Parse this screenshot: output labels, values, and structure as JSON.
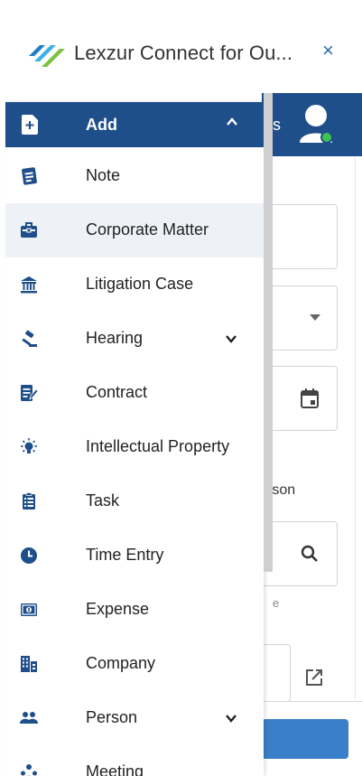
{
  "window": {
    "title": "Lexzur Connect for Ou...",
    "close_glyph": "×",
    "brand_color": "#1f4f8a",
    "accent_color": "#2b6cb0"
  },
  "background_form": {
    "header_text": "s",
    "person_fragment": "rson",
    "hint_fragment": "e"
  },
  "menu": {
    "header_label": "Add",
    "items": [
      {
        "label": "Note",
        "icon": "note-icon"
      },
      {
        "label": "Corporate Matter",
        "icon": "briefcase-icon",
        "active": true
      },
      {
        "label": "Litigation Case",
        "icon": "courthouse-icon"
      },
      {
        "label": "Hearing",
        "icon": "gavel-icon",
        "expandable": true
      },
      {
        "label": "Contract",
        "icon": "contract-edit-icon"
      },
      {
        "label": "Intellectual Property",
        "icon": "lightbulb-icon"
      },
      {
        "label": "Task",
        "icon": "clipboard-list-icon"
      },
      {
        "label": "Time Entry",
        "icon": "clock-icon"
      },
      {
        "label": "Expense",
        "icon": "receipt-icon"
      },
      {
        "label": "Company",
        "icon": "building-icon"
      },
      {
        "label": "Person",
        "icon": "people-icon",
        "expandable": true
      },
      {
        "label": "Meeting",
        "icon": "meeting-icon"
      }
    ]
  }
}
